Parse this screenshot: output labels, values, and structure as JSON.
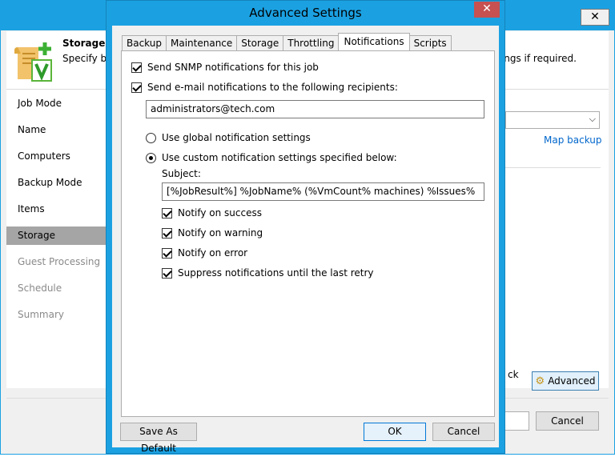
{
  "background_window": {
    "close_glyph": "✕",
    "header": {
      "title": "Storage",
      "subtitle_left": "Specify ba",
      "subtitle_right": "ngs if required."
    },
    "nav_items": [
      {
        "label": "Job Mode",
        "state": "normal"
      },
      {
        "label": "Name",
        "state": "normal"
      },
      {
        "label": "Computers",
        "state": "normal"
      },
      {
        "label": "Backup Mode",
        "state": "normal"
      },
      {
        "label": "Items",
        "state": "normal"
      },
      {
        "label": "Storage",
        "state": "active"
      },
      {
        "label": "Guest Processing",
        "state": "disabled"
      },
      {
        "label": "Schedule",
        "state": "disabled"
      },
      {
        "label": "Summary",
        "state": "disabled"
      }
    ],
    "map_backup_link": "Map backup",
    "partial_text": "ck",
    "advanced_button": "Advanced",
    "cancel_button": "Cancel"
  },
  "dialog": {
    "title": "Advanced Settings",
    "close_glyph": "✕",
    "tabs": [
      "Backup",
      "Maintenance",
      "Storage",
      "Throttling",
      "Notifications",
      "Scripts"
    ],
    "active_tab": "Notifications",
    "snmp": {
      "label": "Send SNMP notifications for this job",
      "checked": true
    },
    "email": {
      "label": "Send e-mail notifications to the following recipients:",
      "checked": true
    },
    "recipients_value": "administrators@tech.com",
    "radio_global": {
      "label": "Use global notification settings",
      "checked": false
    },
    "radio_custom": {
      "label": "Use custom notification settings specified below:",
      "checked": true
    },
    "subject_label": "Subject:",
    "subject_value": "[%JobResult%] %JobName% (%VmCount% machines) %Issues%",
    "notify_success": {
      "label": "Notify on success",
      "checked": true
    },
    "notify_warning": {
      "label": "Notify on warning",
      "checked": true
    },
    "notify_error": {
      "label": "Notify on error",
      "checked": true
    },
    "suppress": {
      "label": "Suppress notifications until the last retry",
      "checked": true
    },
    "buttons": {
      "save_default": "Save As Default",
      "ok": "OK",
      "cancel": "Cancel"
    }
  },
  "colors": {
    "title_bar": "#1ba1e2",
    "close_button": "#c75050",
    "link": "#0066cc",
    "nav_active": "#a5a5a5"
  }
}
